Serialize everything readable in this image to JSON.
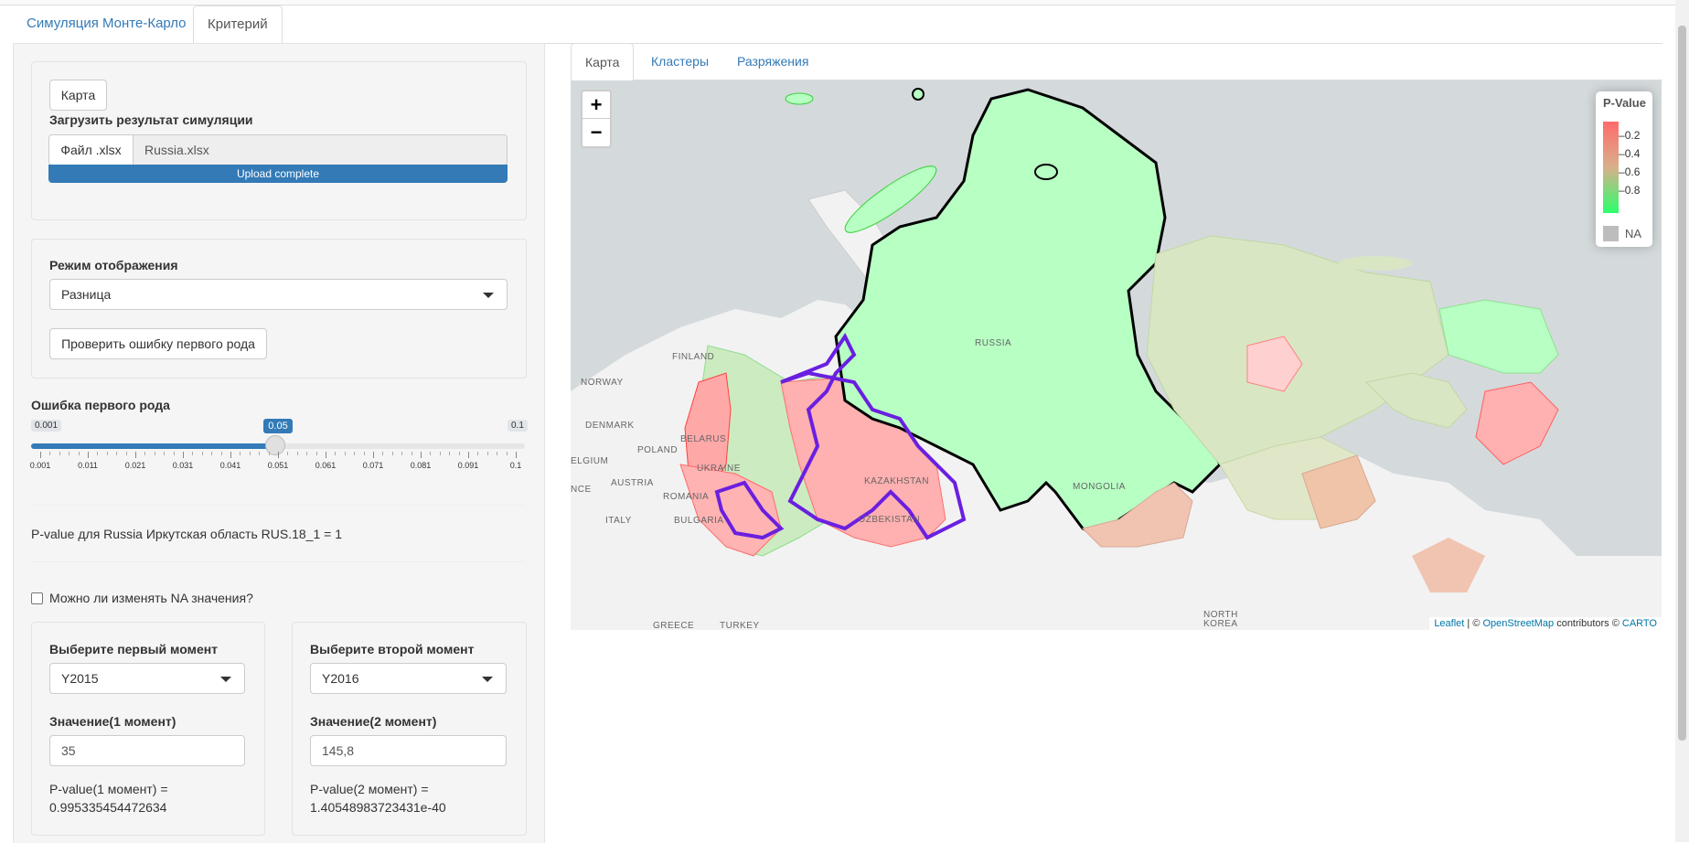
{
  "main_tabs": [
    "Симуляция Монте-Карло",
    "Критерий"
  ],
  "sidebar": {
    "map_button": "Карта",
    "upload_label": "Загрузить результат симуляции",
    "file_button": "Файл .xlsx",
    "file_name": "Russia.xlsx",
    "upload_status": "Upload complete",
    "display_mode_label": "Режим отображения",
    "display_mode_value": "Разница",
    "check_button": "Проверить ошибку первого рода",
    "error_label": "Ошибка первого рода",
    "slider": {
      "min": "0.001",
      "max": "0.1",
      "value": "0.05",
      "fraction": 0.495,
      "ticks": [
        "0.001",
        "0.011",
        "0.021",
        "0.031",
        "0.041",
        "0.051",
        "0.061",
        "0.071",
        "0.081",
        "0.091",
        "0.1"
      ]
    },
    "pvalue_text": "P-value для Russia Иркутская область RUS.18_1 = 1",
    "na_checkbox_label": "Можно ли изменять NA значения?",
    "moment1": {
      "label": "Выберите первый момент",
      "value": "Y2015",
      "value_label": "Значение(1 момент)",
      "input": "35",
      "pvalue_label": "P-value(1 момент) =",
      "pvalue": "0.995335454472634"
    },
    "moment2": {
      "label": "Выберите второй момент",
      "value": "Y2016",
      "value_label": "Значение(2 момент)",
      "input": "145,8",
      "pvalue_label": "P-value(2 момент) =",
      "pvalue": "1.40548983723431e-40"
    }
  },
  "map_tabs": [
    "Карта",
    "Кластеры",
    "Разряжения"
  ],
  "map": {
    "zoom_in": "+",
    "zoom_out": "−",
    "legend": {
      "title": "P-Value",
      "ticks": [
        "0.2",
        "0.4",
        "0.6",
        "0.8"
      ],
      "na": "NA",
      "colors": {
        "low": "#ff6b6b",
        "high": "#2bff6b",
        "na": "#bdbdbd"
      }
    },
    "labels": {
      "russia": "RUSSIA",
      "finland": "FINLAND",
      "norway": "NORWAY",
      "denmark": "DENMARK",
      "poland": "POLAND",
      "belarus": "BELARUS",
      "ukraine": "UKRAINE",
      "romania": "ROMANIA",
      "bulgaria": "BULGARIA",
      "italy": "ITALY",
      "greece": "GREECE",
      "turkey": "TURKEY",
      "austria": "AUSTRIA",
      "belgium": "ELGIUM",
      "france": "NCE",
      "kazakhstan": "KAZAKHSTAN",
      "uzbekistan": "UZBEKISTAN",
      "mongolia": "MONGOLIA",
      "north_korea_1": "NORTH",
      "north_korea_2": "KOREA"
    },
    "attribution": {
      "leaflet": "Leaflet",
      "sep": " | © ",
      "osm": "OpenStreetMap",
      "contrib": " contributors © ",
      "carto": "CARTO"
    }
  }
}
